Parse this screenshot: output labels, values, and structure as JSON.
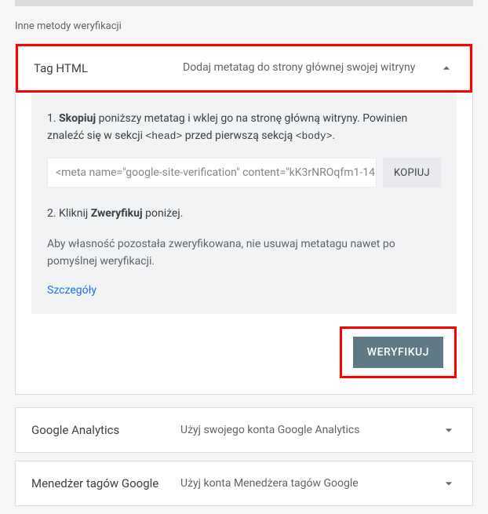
{
  "section_label": "Inne metody weryfikacji",
  "panels": {
    "tag_html": {
      "title": "Tag HTML",
      "desc": "Dodaj metatag do strony głównej swojej witryny",
      "step1_prefix": "1. ",
      "step1_bold": "Skopiuj",
      "step1_text_a": " poniższy metatag i wklej go na stronę główną witryny. Powinien znaleźć się w sekcji ",
      "step1_code1": "<head>",
      "step1_text_b": " przed pierwszą sekcją ",
      "step1_code2": "<body>",
      "step1_text_c": ".",
      "meta_tag": "<meta name=\"google-site-verification\" content=\"kK3rNROqfm1-14",
      "copy_label": "KOPIUJ",
      "step2_prefix": "2. Kliknij ",
      "step2_bold": "Zweryfikuj",
      "step2_suffix": " poniżej.",
      "note": "Aby własność pozostała zweryfikowana, nie usuwaj metatagu nawet po pomyślnej weryfikacji.",
      "details_label": "Szczegóły",
      "verify_label": "WERYFIKUJ"
    },
    "ga": {
      "title": "Google Analytics",
      "desc": "Użyj swojego konta Google Analytics"
    },
    "gtm": {
      "title": "Menedżer tagów Google",
      "desc": "Użyj konta Menedżera tagów Google"
    }
  }
}
